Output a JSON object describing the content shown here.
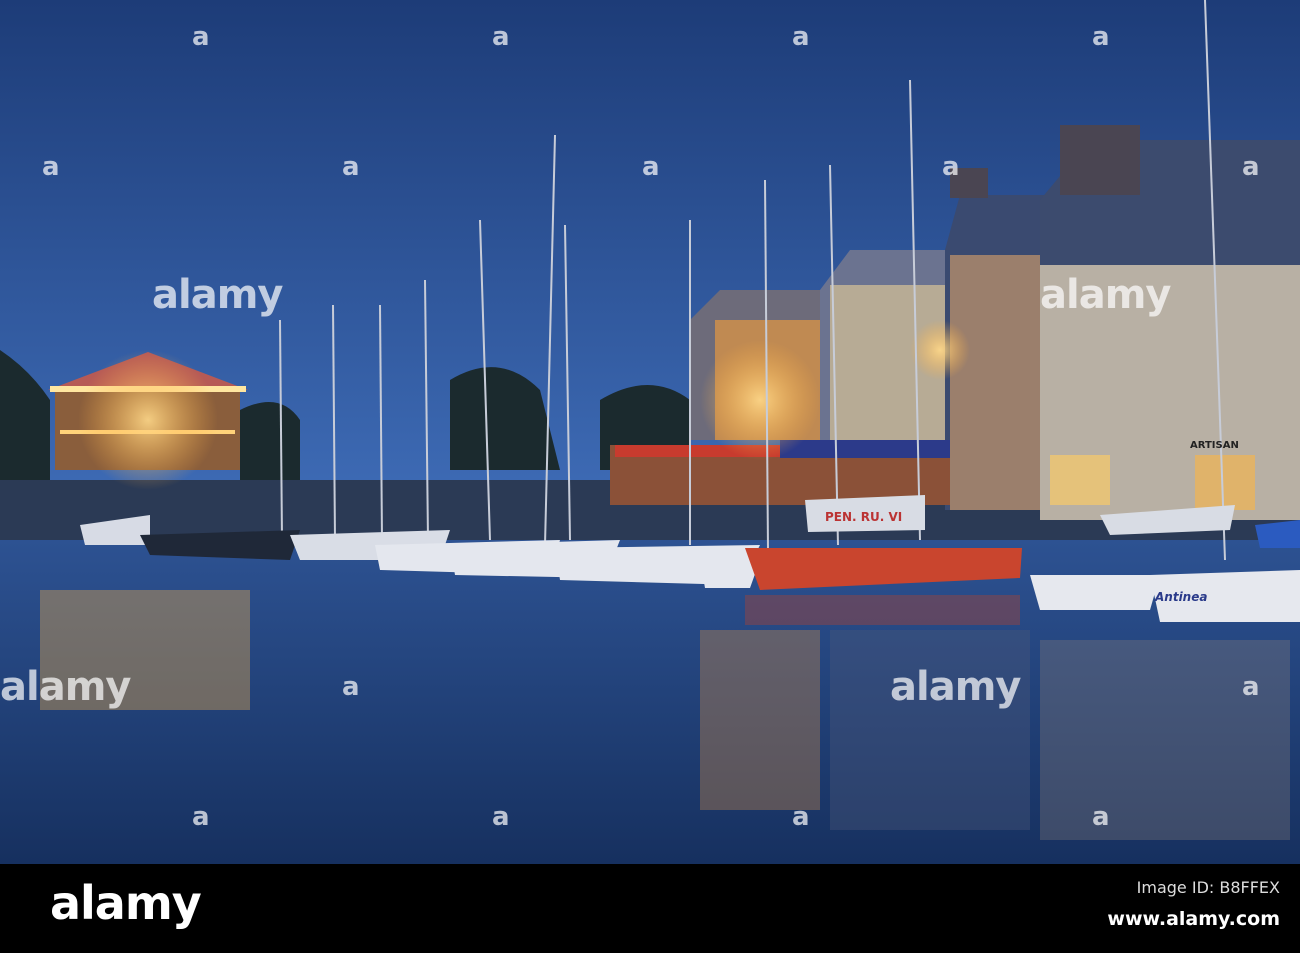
{
  "photo": {
    "subject": "harbour",
    "boat_sail_label": "PEN. RU. VI",
    "shop_sign": "ARTISAN",
    "boat_stern_name": "Antinea"
  },
  "watermark": {
    "logo": "alamy",
    "letter": "a"
  },
  "footer": {
    "logo": "alamy",
    "image_id": "Image ID: B8FFEX",
    "site": "www.alamy.com"
  }
}
